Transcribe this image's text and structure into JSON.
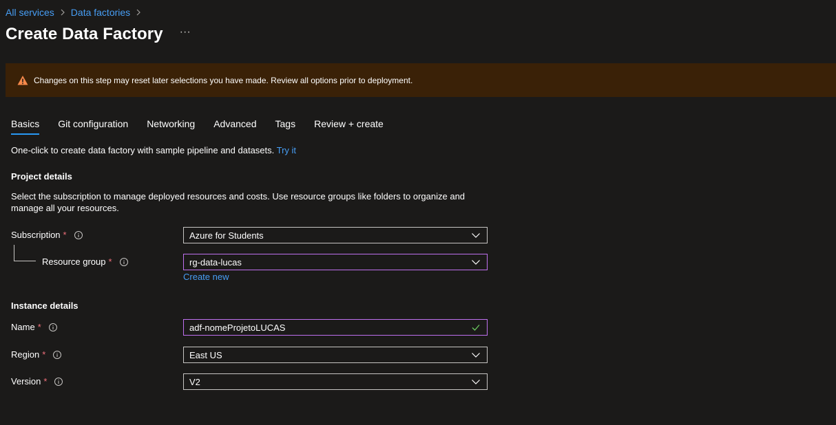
{
  "breadcrumb": {
    "items": [
      {
        "label": "All services"
      },
      {
        "label": "Data factories"
      }
    ]
  },
  "page": {
    "title": "Create Data Factory",
    "more": "···"
  },
  "warning": {
    "text": "Changes on this step may reset later selections you have made. Review all options prior to deployment.",
    "color": "#3a2107"
  },
  "tabs": [
    {
      "label": "Basics",
      "active": true
    },
    {
      "label": "Git configuration"
    },
    {
      "label": "Networking"
    },
    {
      "label": "Advanced"
    },
    {
      "label": "Tags"
    },
    {
      "label": "Review + create"
    }
  ],
  "intro": {
    "text": "One-click to create data factory with sample pipeline and datasets. ",
    "link": "Try it"
  },
  "project": {
    "title": "Project details",
    "description": "Select the subscription to manage deployed resources and costs. Use resource groups like folders to organize and manage all your resources."
  },
  "fields": {
    "subscription": {
      "label": "Subscription",
      "required": "*",
      "value": "Azure for Students"
    },
    "resource_group": {
      "label": "Resource group",
      "required": "*",
      "value": "rg-data-lucas",
      "create_new": "Create new"
    },
    "name": {
      "label": "Name",
      "required": "*",
      "value": "adf-nomeProjetoLUCAS"
    },
    "region": {
      "label": "Region",
      "required": "*",
      "value": "East US"
    },
    "version": {
      "label": "Version",
      "required": "*",
      "value": "V2"
    }
  },
  "instance": {
    "title": "Instance details"
  },
  "colors": {
    "accent": "#479ef5",
    "focus": "#c071f0",
    "required": "#f1707b",
    "valid": "#6ccb5f"
  }
}
